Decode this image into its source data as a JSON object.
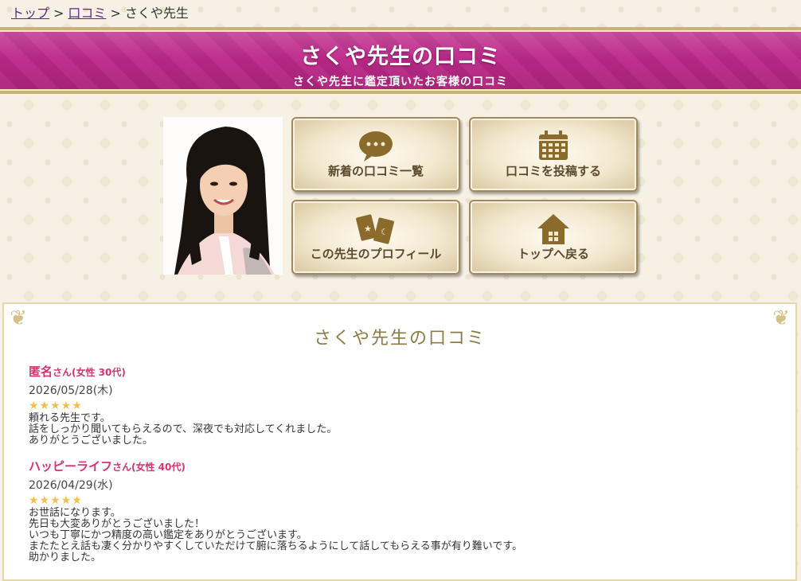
{
  "breadcrumb": {
    "top": "トップ",
    "reviews": "口コミ",
    "current": "さくや先生",
    "sep": ">"
  },
  "banner": {
    "title": "さくや先生の口コミ",
    "subtitle": "さくや先生に鑑定頂いたお客様の口コミ"
  },
  "nav": {
    "latest": "新着の口コミ一覧",
    "post": "口コミを投稿する",
    "profile": "この先生のプロフィール",
    "home": "トップへ戻る"
  },
  "panel": {
    "title": "さくや先生の口コミ"
  },
  "reviews": [
    {
      "name": "匿名",
      "suffix": "さん(女性 30代)",
      "date": "2026/05/28(木)",
      "stars": "★★★★★",
      "rating": 5,
      "lines": [
        "頼れる先生です。",
        "話をしっかり聞いてもらえるので、深夜でも対応してくれました。",
        "ありがとうございました。"
      ]
    },
    {
      "name": "ハッピーライフ",
      "suffix": "さん(女性 40代)",
      "date": "2026/04/29(水)",
      "stars": "★★★★★",
      "rating": 5,
      "lines": [
        "お世話になります。",
        "先日も大変ありがとうございました！",
        "いつも丁寧にかつ精度の高い鑑定をありがとうございます。",
        "またたとえ話も凄く分かりやすくしていただけて腑に落ちるようにして話してもらえる事が有り難いです。",
        "助かりました。"
      ]
    }
  ],
  "colors": {
    "banner": "#bd2c8a",
    "gold": "#c9b27a",
    "name": "#d8326f",
    "star": "#f2c04a"
  }
}
